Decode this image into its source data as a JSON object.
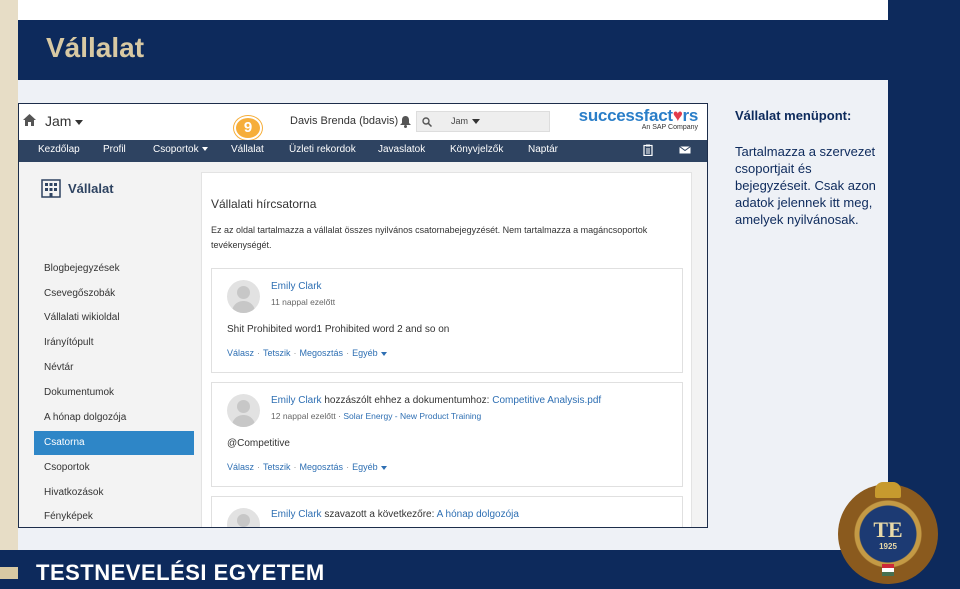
{
  "slide": {
    "title": "Vállalat",
    "footer": "TESTNEVELÉSI EGYETEM",
    "seal": {
      "monogram": "TE",
      "year": "1925"
    },
    "description": {
      "heading": "Vállalat menüpont:",
      "body": "Tartalmazza a szervezet csoportjait és bejegyzéseit. Csak azon adatok jelennek itt meg, amelyek nyilvánosak."
    }
  },
  "app": {
    "workspace": "Jam",
    "step_badge": "9",
    "user": "Davis Brenda (bdavis)",
    "search_scope": "Jam",
    "brand": {
      "name_part1": "successfact",
      "name_heart": "♥",
      "name_part2": "rs",
      "tagline": "An SAP Company"
    },
    "nav": [
      "Kezdőlap",
      "Profil",
      "Csoportok",
      "Vállalat",
      "Üzleti rekordok",
      "Javaslatok",
      "Könyvjelzők",
      "Naptár"
    ],
    "sidebar": {
      "title": "Vállalat",
      "items": [
        "Blogbejegyzések",
        "Csevegőszobák",
        "Vállalati wikioldal",
        "Irányítópult",
        "Névtár",
        "Dokumentumok",
        "A hónap dolgozója",
        "Csatorna",
        "Csoportok",
        "Hivatkozások",
        "Fényképek"
      ],
      "active_item": "Csatorna"
    },
    "feed": {
      "title": "Vállalati hírcsatorna",
      "description": "Ez az oldal tartalmazza a vállalat összes nyilvános csatornabejegyzését. Nem tartalmazza a magáncsoportok tevékenységét.",
      "posts": [
        {
          "author": "Emily Clark",
          "time": "11 nappal ezelőtt",
          "text": "Shit Prohibited word1 Prohibited word 2 and so on",
          "actions": [
            "Válasz",
            "Tetszik",
            "Megosztás",
            "Egyéb"
          ]
        },
        {
          "author": "Emily Clark",
          "action_text": " hozzászólt ehhez a dokumentumhoz: ",
          "target": "Competitive Analysis.pdf",
          "time": "12 nappal ezelőtt",
          "separator": " · ",
          "context": "Solar Energy - New Product Training",
          "text": "@Competitive",
          "actions": [
            "Válasz",
            "Tetszik",
            "Megosztás",
            "Egyéb"
          ]
        },
        {
          "author": "Emily Clark",
          "action_text": " szavazott a következőre: ",
          "target": "A hónap dolgozója"
        }
      ]
    }
  },
  "colors": {
    "brand_navy": "#0d2a5c",
    "beige": "#d8c9a3",
    "app_nav": "#2e4361",
    "active_blue": "#2e86c7",
    "link_blue": "#2e6fb3",
    "badge_orange": "#f6ae3a"
  },
  "icons": [
    "home-icon",
    "bell-icon",
    "search-icon",
    "clipboard-icon",
    "mail-icon",
    "building-icon",
    "avatar-icon"
  ]
}
